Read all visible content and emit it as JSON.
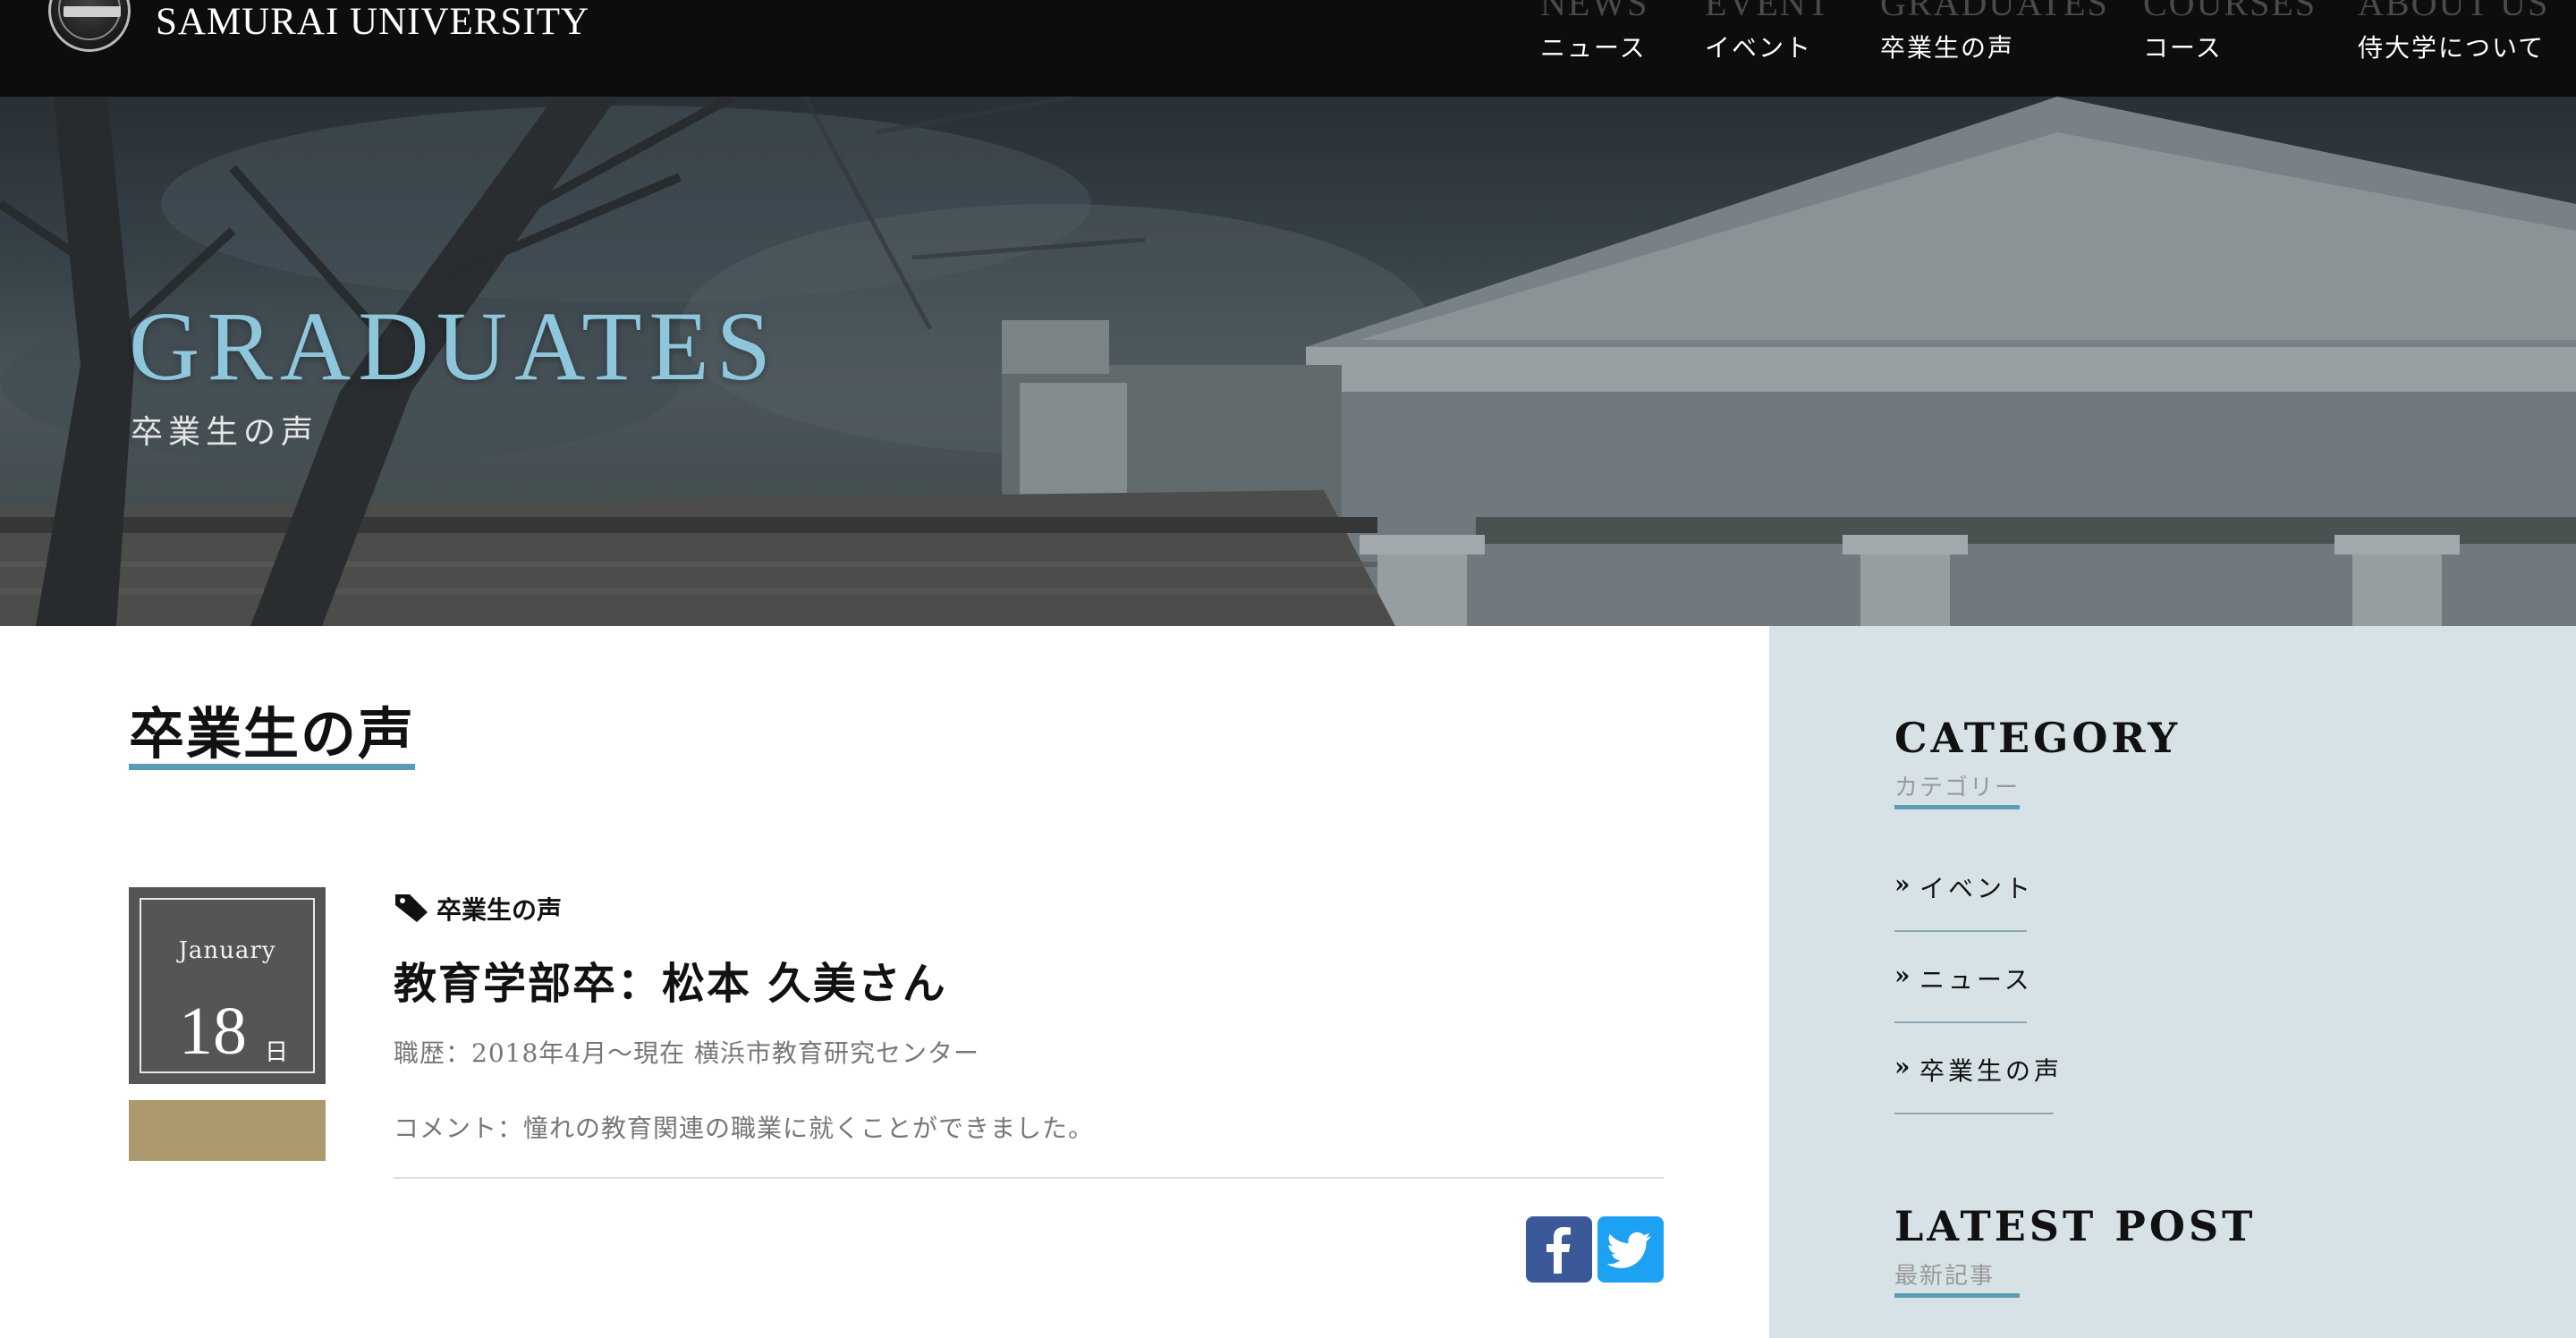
{
  "header": {
    "site_name": "SAMURAI UNIVERSITY",
    "nav": [
      {
        "en": "NEWS",
        "jp": "ニュース"
      },
      {
        "en": "EVENT",
        "jp": "イベント"
      },
      {
        "en": "GRADUATES",
        "jp": "卒業生の声"
      },
      {
        "en": "COURSES",
        "jp": "コース"
      },
      {
        "en": "ABOUT US",
        "jp": "侍大学について"
      }
    ]
  },
  "hero": {
    "title": "GRADUATES",
    "subtitle": "卒業生の声"
  },
  "main": {
    "heading": "卒業生の声",
    "post": {
      "month": "January",
      "day": "18",
      "day_unit": "日",
      "category": "卒業生の声",
      "title": "教育学部卒：松本 久美さん",
      "career": "職歴：2018年4月〜現在 横浜市教育研究センター",
      "comment": "コメント：憧れの教育関連の職業に就くことができました。"
    }
  },
  "sidebar": {
    "category_heading": "CATEGORY",
    "category_sub": "カテゴリー",
    "categories": [
      "イベント",
      "ニュース",
      "卒業生の声"
    ],
    "latest_heading": "LATEST POST",
    "latest_sub": "最新記事"
  },
  "colors": {
    "accent": "#5b9bb5",
    "hero_title": "#8ec6dc",
    "date_box": "#555555",
    "date_band": "#ac9a6e",
    "sidebar_bg": "#d7e2e7",
    "facebook": "#3b5998",
    "twitter": "#1da1f2"
  },
  "icons": [
    "university-emblem-icon",
    "tag-icon",
    "chevron-double-right-icon",
    "facebook-icon",
    "twitter-icon"
  ]
}
